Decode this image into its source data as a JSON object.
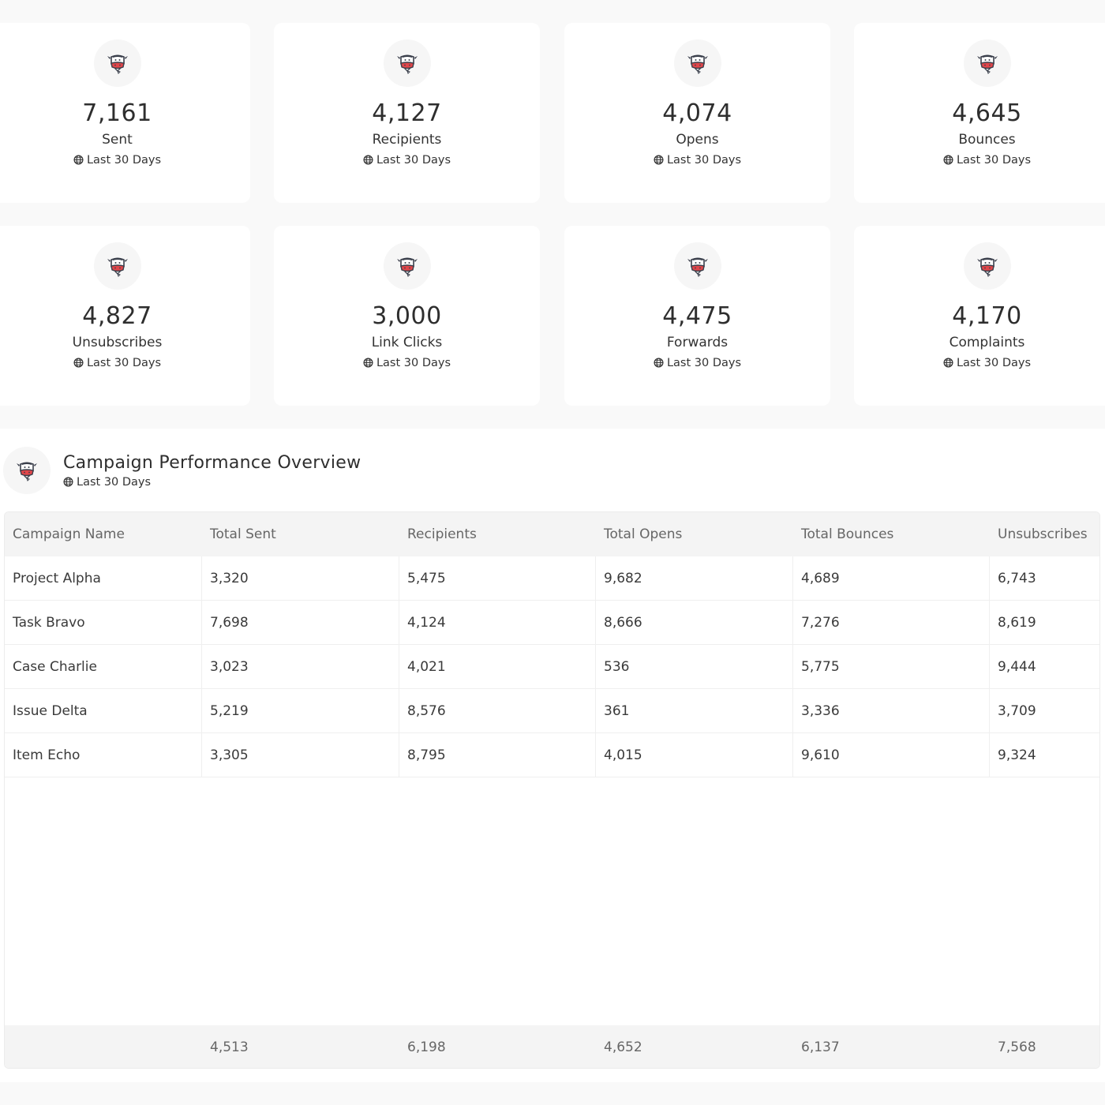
{
  "stats": [
    {
      "value": "7,161",
      "label": "Sent",
      "period": "Last 30 Days"
    },
    {
      "value": "4,127",
      "label": "Recipients",
      "period": "Last 30 Days"
    },
    {
      "value": "4,074",
      "label": "Opens",
      "period": "Last 30 Days"
    },
    {
      "value": "4,645",
      "label": "Bounces",
      "period": "Last 30 Days"
    },
    {
      "value": "4,827",
      "label": "Unsubscribes",
      "period": "Last 30 Days"
    },
    {
      "value": "3,000",
      "label": "Link Clicks",
      "period": "Last 30 Days"
    },
    {
      "value": "4,475",
      "label": "Forwards",
      "period": "Last 30 Days"
    },
    {
      "value": "4,170",
      "label": "Complaints",
      "period": "Last 30 Days"
    }
  ],
  "overview": {
    "title": "Campaign Performance Overview",
    "period": "Last 30 Days",
    "columns": [
      "Campaign Name",
      "Total Sent",
      "Recipients",
      "Total Opens",
      "Total Bounces",
      "Unsubscribes"
    ],
    "rows": [
      [
        "Project Alpha",
        "3,320",
        "5,475",
        "9,682",
        "4,689",
        "6,743"
      ],
      [
        "Task Bravo",
        "7,698",
        "4,124",
        "8,666",
        "7,276",
        "8,619"
      ],
      [
        "Case Charlie",
        "3,023",
        "4,021",
        "536",
        "5,775",
        "9,444"
      ],
      [
        "Issue Delta",
        "5,219",
        "8,576",
        "361",
        "3,336",
        "3,709"
      ],
      [
        "Item Echo",
        "3,305",
        "8,795",
        "4,015",
        "9,610",
        "9,324"
      ]
    ],
    "footer": [
      "",
      "4,513",
      "6,198",
      "4,652",
      "6,137",
      "7,568"
    ]
  },
  "icons": {
    "card_badge": "cow-mascot-icon",
    "period_icon": "globe-icon"
  },
  "colors": {
    "background": "#f9f9f9",
    "card": "#ffffff",
    "mascot_red": "#e0464a"
  }
}
